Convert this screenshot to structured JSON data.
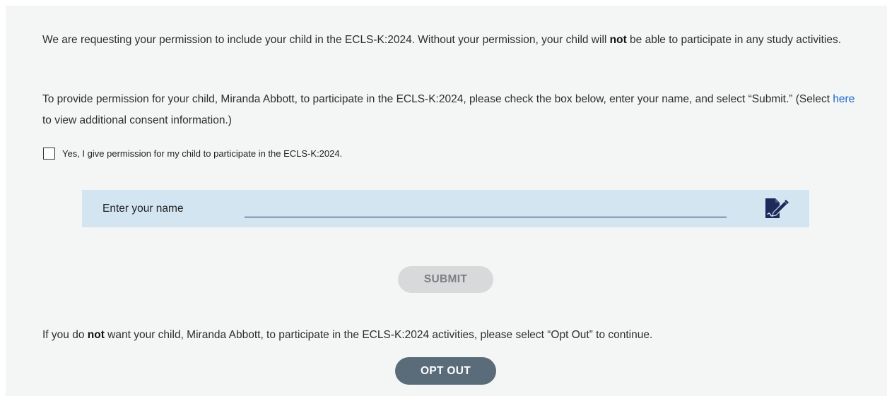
{
  "consent": {
    "intro": {
      "before": "We are requesting your permission to include your child in the ECLS-K:2024. Without your permission, your child will ",
      "emphasis": "not",
      "after": " be able to participate in any study activities."
    },
    "instructions": {
      "before": "To provide permission for your child, Miranda Abbott, to participate in the ECLS-K:2024, please check the box below, enter your name, and select “Submit.” (Select ",
      "link_label": "here",
      "after": " to view additional consent information.)"
    },
    "checkbox_label": "Yes, I give permission for my child to participate in the ECLS-K:2024.",
    "checkbox_checked": false
  },
  "name_entry": {
    "label": "Enter your name",
    "value": "",
    "icon": "signature-pen-icon"
  },
  "submit_label": "SUBMIT",
  "opt_out": {
    "before": "If you do ",
    "emphasis": "not",
    "after": " want your child, Miranda Abbott, to participate in the ECLS-K:2024 activities, please select “Opt Out” to continue.",
    "button_label": "OPT OUT"
  },
  "colors": {
    "panel_bg": "#f4f5f5",
    "name_box_bg": "#d4e5f2",
    "link": "#1a66c9",
    "submit_disabled_bg": "#d7d9db",
    "opt_out_bg": "#5a6b7a"
  }
}
